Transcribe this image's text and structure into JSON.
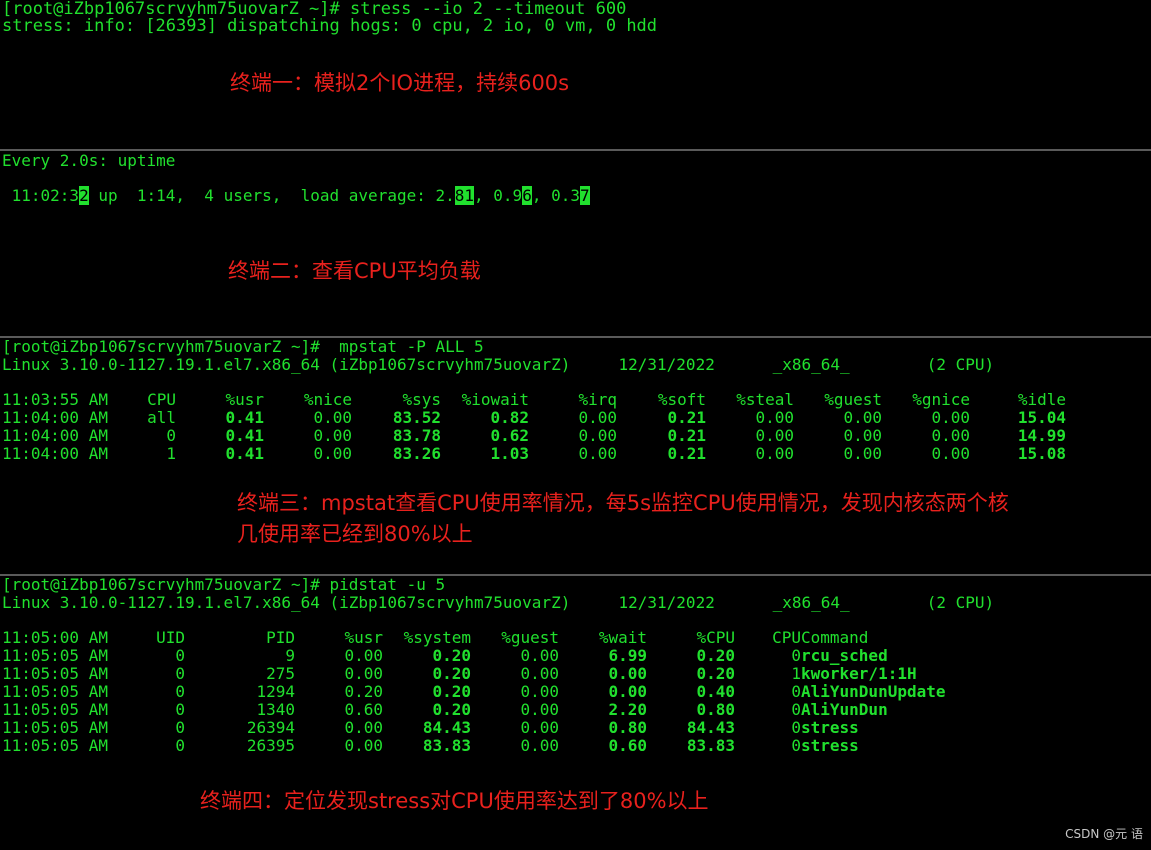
{
  "terminal1": {
    "prompt_line": "[root@iZbp1067scrvyhm75uovarZ ~]# stress --io 2 --timeout 600",
    "output_line": "stress: info: [26393] dispatching hogs: 0 cpu, 2 io, 0 vm, 0 hdd",
    "caption": "终端一：模拟2个IO进程，持续600s"
  },
  "terminal2": {
    "header": "Every 2.0s: uptime",
    "uptime": {
      "p1": " 11:02:3",
      "c1": "2",
      "p2": " up  1:14,  4 users,  load average: 2.",
      "c2": "81",
      "p3": ", 0.9",
      "c3": "6",
      "p4": ", 0.3",
      "c4": "7"
    },
    "caption": "终端二：查看CPU平均负载"
  },
  "terminal3": {
    "prompt_line": "[root@iZbp1067scrvyhm75uovarZ ~]#  mpstat -P ALL 5",
    "sysinfo": "Linux 3.10.0-1127.19.1.el7.x86_64 (iZbp1067scrvyhm75uovarZ)     12/31/2022      _x86_64_        (2 CPU)",
    "columns": [
      "11:03:55 AM",
      "CPU",
      "%usr",
      "%nice",
      "%sys",
      "%iowait",
      "%irq",
      "%soft",
      "%steal",
      "%guest",
      "%gnice",
      "%idle"
    ],
    "rows": [
      [
        "11:04:00 AM",
        "all",
        "0.41",
        "0.00",
        "83.52",
        "0.82",
        "0.00",
        "0.21",
        "0.00",
        "0.00",
        "0.00",
        "15.04"
      ],
      [
        "11:04:00 AM",
        "0",
        "0.41",
        "0.00",
        "83.78",
        "0.62",
        "0.00",
        "0.21",
        "0.00",
        "0.00",
        "0.00",
        "14.99"
      ],
      [
        "11:04:00 AM",
        "1",
        "0.41",
        "0.00",
        "83.26",
        "1.03",
        "0.00",
        "0.21",
        "0.00",
        "0.00",
        "0.00",
        "15.08"
      ]
    ],
    "caption_line1": "终端三：mpstat查看CPU使用率情况，每5s监控CPU使用情况，发现内核态两个核",
    "caption_line2": "几使用率已经到80%以上"
  },
  "terminal4": {
    "prompt_line": "[root@iZbp1067scrvyhm75uovarZ ~]# pidstat -u 5",
    "sysinfo": "Linux 3.10.0-1127.19.1.el7.x86_64 (iZbp1067scrvyhm75uovarZ)     12/31/2022      _x86_64_        (2 CPU)",
    "columns": [
      "11:05:00 AM",
      "UID",
      "PID",
      "%usr",
      "%system",
      "%guest",
      "%wait",
      "%CPU",
      "CPU",
      "Command"
    ],
    "rows": [
      [
        "11:05:05 AM",
        "0",
        "9",
        "0.00",
        "0.20",
        "0.00",
        "6.99",
        "0.20",
        "0",
        "rcu_sched"
      ],
      [
        "11:05:05 AM",
        "0",
        "275",
        "0.00",
        "0.20",
        "0.00",
        "0.00",
        "0.20",
        "1",
        "kworker/1:1H"
      ],
      [
        "11:05:05 AM",
        "0",
        "1294",
        "0.20",
        "0.20",
        "0.00",
        "0.00",
        "0.40",
        "0",
        "AliYunDunUpdate"
      ],
      [
        "11:05:05 AM",
        "0",
        "1340",
        "0.60",
        "0.20",
        "0.00",
        "2.20",
        "0.80",
        "0",
        "AliYunDun"
      ],
      [
        "11:05:05 AM",
        "0",
        "26394",
        "0.00",
        "84.43",
        "0.00",
        "0.80",
        "84.43",
        "0",
        "stress"
      ],
      [
        "11:05:05 AM",
        "0",
        "26395",
        "0.00",
        "83.83",
        "0.00",
        "0.60",
        "83.83",
        "0",
        "stress"
      ]
    ],
    "caption": "终端四：定位发现stress对CPU使用率达到了80%以上"
  },
  "watermark": "CSDN @元 语",
  "colors": {
    "terminal_green": "#21e02e",
    "caption_red": "#e8211d",
    "background": "#000000"
  }
}
